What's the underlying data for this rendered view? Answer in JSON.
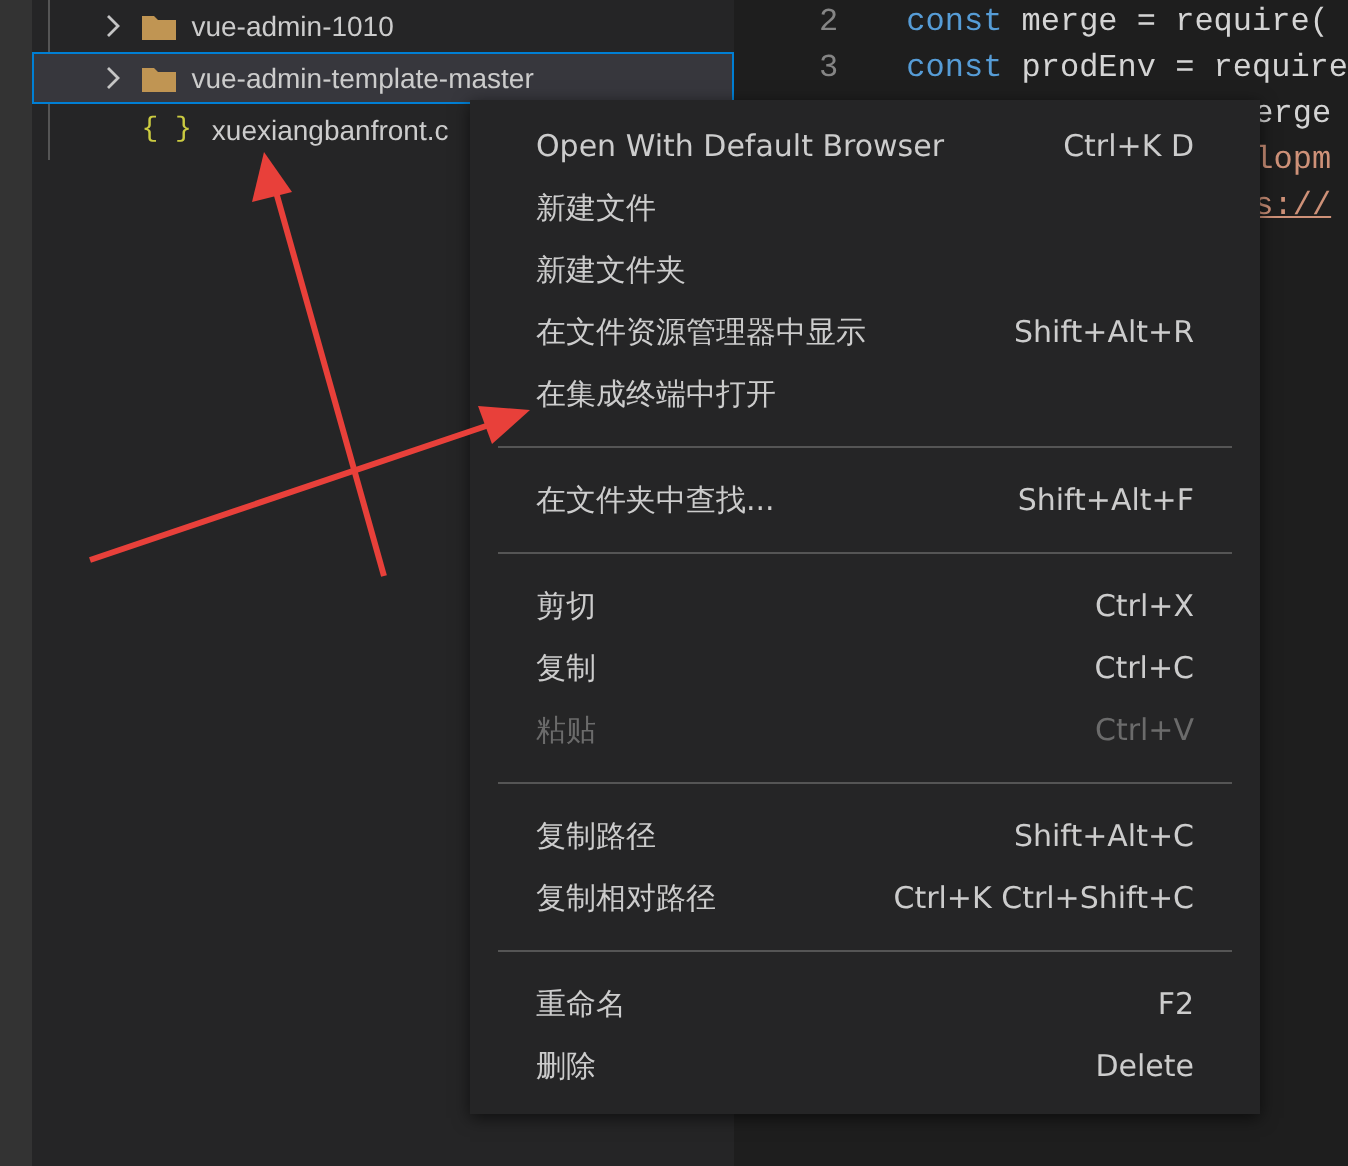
{
  "explorer": {
    "items": [
      {
        "kind": "folder",
        "label": "vue-admin-1010",
        "expanded": false,
        "selected": false
      },
      {
        "kind": "folder",
        "label": "vue-admin-template-master",
        "expanded": false,
        "selected": true
      },
      {
        "kind": "json",
        "label": "xuexiangbanfront.c",
        "icon": "{ }"
      }
    ]
  },
  "editor": {
    "lines": [
      {
        "number": "2",
        "tokens": [
          {
            "kind": "keyword",
            "text": "const"
          },
          {
            "kind": "plain",
            "text": " merge = require("
          }
        ]
      },
      {
        "number": "3",
        "tokens": [
          {
            "kind": "keyword",
            "text": "const"
          },
          {
            "kind": "plain",
            "text": " prodEnv = require"
          }
        ]
      },
      {
        "tokens": [
          {
            "kind": "plain",
            "text": "erge"
          }
        ]
      },
      {
        "tokens": [
          {
            "kind": "string",
            "text": "lopm"
          }
        ]
      },
      {
        "tokens": [
          {
            "kind": "link",
            "text": "s://"
          }
        ]
      }
    ]
  },
  "context_menu": {
    "groups": [
      [
        {
          "label": "Open With Default Browser",
          "shortcut": "Ctrl+K D",
          "disabled": false
        },
        {
          "label": "新建文件",
          "disabled": false
        },
        {
          "label": "新建文件夹",
          "disabled": false
        },
        {
          "label": "在文件资源管理器中显示",
          "shortcut": "Shift+Alt+R",
          "disabled": false
        },
        {
          "label": "在集成终端中打开",
          "disabled": false
        }
      ],
      [
        {
          "label": "在文件夹中查找...",
          "shortcut": "Shift+Alt+F",
          "disabled": false
        }
      ],
      [
        {
          "label": "剪切",
          "shortcut": "Ctrl+X",
          "disabled": false
        },
        {
          "label": "复制",
          "shortcut": "Ctrl+C",
          "disabled": false
        },
        {
          "label": "粘贴",
          "shortcut": "Ctrl+V",
          "disabled": true
        }
      ],
      [
        {
          "label": "复制路径",
          "shortcut": "Shift+Alt+C",
          "disabled": false
        },
        {
          "label": "复制相对路径",
          "shortcut": "Ctrl+K Ctrl+Shift+C",
          "disabled": false
        }
      ],
      [
        {
          "label": "重命名",
          "shortcut": "F2",
          "disabled": false
        },
        {
          "label": "删除",
          "shortcut": "Delete",
          "disabled": false
        }
      ]
    ]
  }
}
